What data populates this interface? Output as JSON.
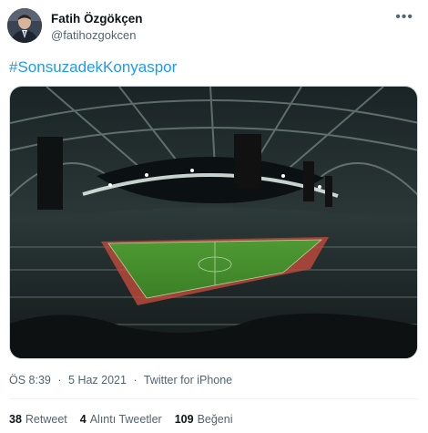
{
  "tweet": {
    "author_name": "Fatih Özgökçen",
    "author_handle": "@fatihozgokcen",
    "more_icon": "more-dots-icon",
    "text": "#SonsuzadekKonyaspor",
    "time": "ÖS 8:39",
    "separator": "·",
    "date": "5 Haz 2021",
    "source": "Twitter for iPhone",
    "stats": {
      "retweets_count": "38",
      "retweets_label": "Retweet",
      "quotes_count": "4",
      "quotes_label": "Alıntı Tweetler",
      "likes_count": "109",
      "likes_label": "Beğeni"
    },
    "colors": {
      "link": "#1d9bf0",
      "secondary_text": "#536471",
      "pitch": "#3f8a2a"
    }
  }
}
